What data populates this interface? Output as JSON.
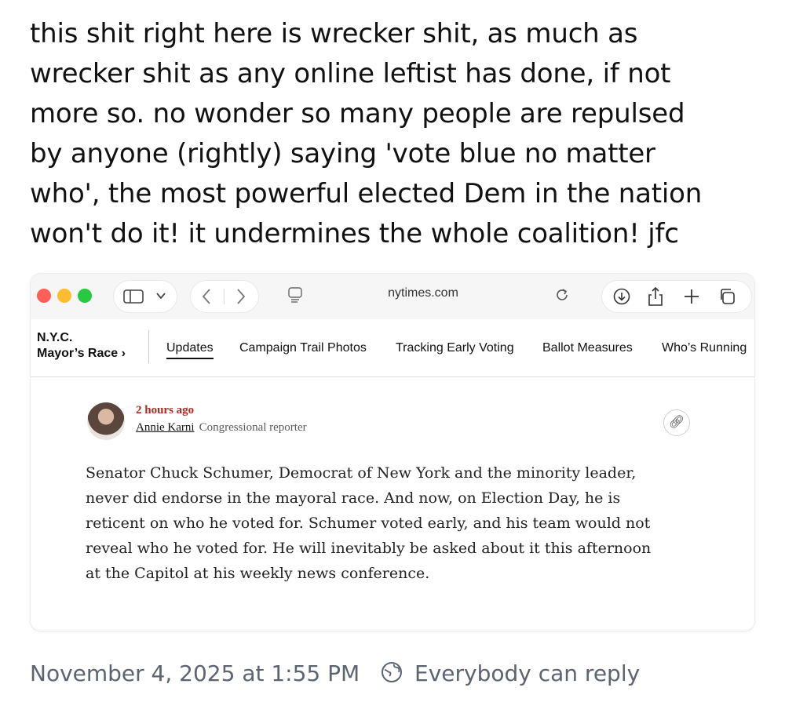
{
  "post": {
    "lines": [
      "this shit right here is wrecker shit, as much as",
      "wrecker shit as any online leftist has done, if not",
      "more so. no wonder so many people are repulsed",
      "by anyone (rightly) saying 'vote blue no matter",
      "who', the most powerful elected Dem in the nation",
      "won't do it! it undermines the whole coalition! jfc"
    ]
  },
  "browser": {
    "url": "nytimes.com",
    "traffic_colors": [
      "#fe5f57",
      "#febc2e",
      "#28c840"
    ],
    "icons": [
      "sidebar-icon",
      "chevron-down-icon",
      "back-icon",
      "forward-icon",
      "reader-icon",
      "reload-icon",
      "download-icon",
      "share-icon",
      "new-tab-icon",
      "tabs-icon"
    ]
  },
  "subnav": {
    "section_line1": "N.Y.C.",
    "section_line2": "Mayor’s Race ›",
    "items": [
      "Updates",
      "Campaign Trail Photos",
      "Tracking Early Voting",
      "Ballot Measures",
      "Who’s Running"
    ]
  },
  "article": {
    "timestamp": "2 hours ago",
    "author": "Annie Karni",
    "role": "Congressional reporter",
    "body_lines": [
      "Senator Chuck Schumer, Democrat of New York and the minority leader,",
      "never did endorse in the mayoral race. And now, on Election Day, he is",
      "reticent on who he voted for. Schumer voted early, and his team would not",
      "reveal who he voted for. He will inevitably be asked about it this afternoon",
      "at the Capitol at his weekly news conference."
    ]
  },
  "footer": {
    "date": "November 4, 2025 at 1:55 PM",
    "reply_setting": "Everybody can reply"
  },
  "colors": {
    "timestamp_red": "#b0271f",
    "footer_gray": "#5b6470"
  }
}
